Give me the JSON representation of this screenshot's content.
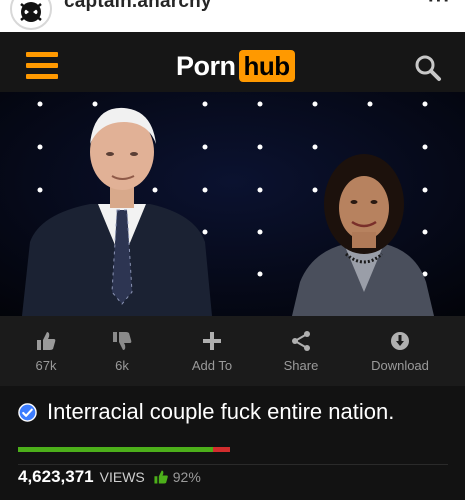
{
  "instagram": {
    "username": "captain.anarchy",
    "more_icon": "more-horizontal-icon",
    "avatar_icon": "skull-avatar-icon"
  },
  "topbar": {
    "menu_icon": "hamburger-menu-icon",
    "logo_part1": "Porn",
    "logo_part2": "hub",
    "search_icon": "search-icon",
    "accent": "#ff9900"
  },
  "video": {
    "thumbnail": "video-thumbnail"
  },
  "actions": [
    {
      "icon": "thumbs-up-icon",
      "label": "67k"
    },
    {
      "icon": "thumbs-down-icon",
      "label": "6k"
    },
    {
      "icon": "plus-icon",
      "label": "Add To"
    },
    {
      "icon": "share-icon",
      "label": "Share"
    },
    {
      "icon": "download-icon",
      "label": "Download"
    }
  ],
  "title": {
    "text": "Interracial couple fuck entire nation.",
    "verified_icon": "verified-check-icon"
  },
  "stats": {
    "views_count": "4,623,371",
    "views_label": "VIEWS",
    "rating_percent": "92%",
    "rating_fraction": 0.92,
    "thumb_icon": "thumbs-up-icon",
    "positive_color": "#4caf1a",
    "negative_color": "#d12d2d"
  }
}
